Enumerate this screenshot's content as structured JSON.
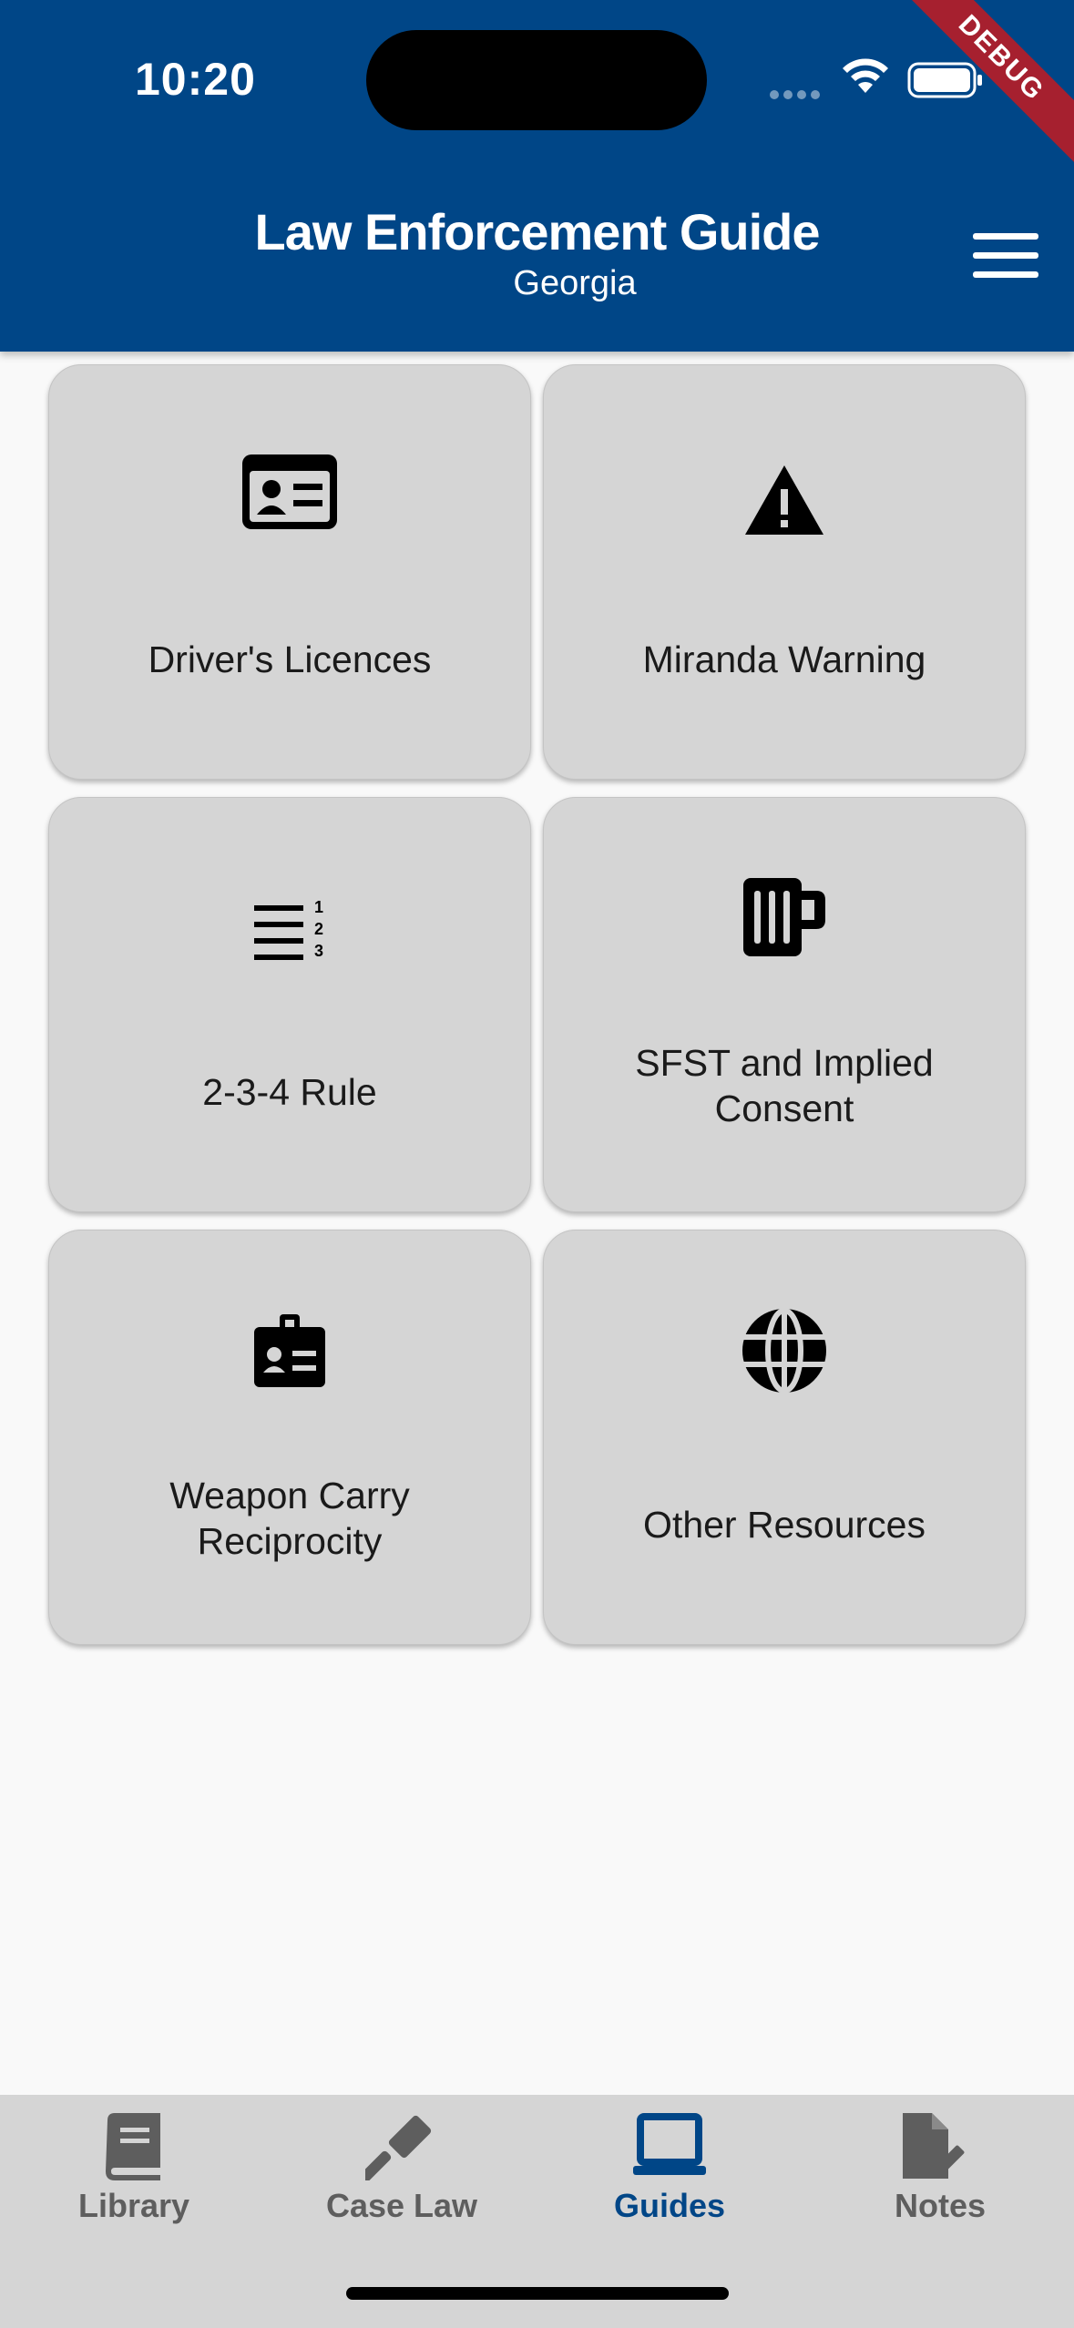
{
  "status_bar": {
    "time": "10:20",
    "debug_label": "DEBUG"
  },
  "header": {
    "title": "Law Enforcement Guide",
    "subtitle": "Georgia"
  },
  "grid": [
    {
      "label": "Driver's Licences",
      "icon": "id-card-icon"
    },
    {
      "label": "Miranda Warning",
      "icon": "warning-icon"
    },
    {
      "label": "2-3-4 Rule",
      "icon": "numbered-list-icon"
    },
    {
      "label": "SFST and Implied Consent",
      "icon": "beer-mug-icon"
    },
    {
      "label": "Weapon Carry Reciprocity",
      "icon": "badge-icon"
    },
    {
      "label": "Other Resources",
      "icon": "globe-icon"
    }
  ],
  "tabbar": {
    "tabs": [
      {
        "label": "Library",
        "icon": "book-icon"
      },
      {
        "label": "Case Law",
        "icon": "gavel-icon"
      },
      {
        "label": "Guides",
        "icon": "laptop-icon",
        "active": true
      },
      {
        "label": "Notes",
        "icon": "note-edit-icon"
      }
    ]
  },
  "colors": {
    "primary": "#004687",
    "card": "#d5d5d5",
    "background": "#f9f9f9",
    "debug": "#a6202f"
  }
}
